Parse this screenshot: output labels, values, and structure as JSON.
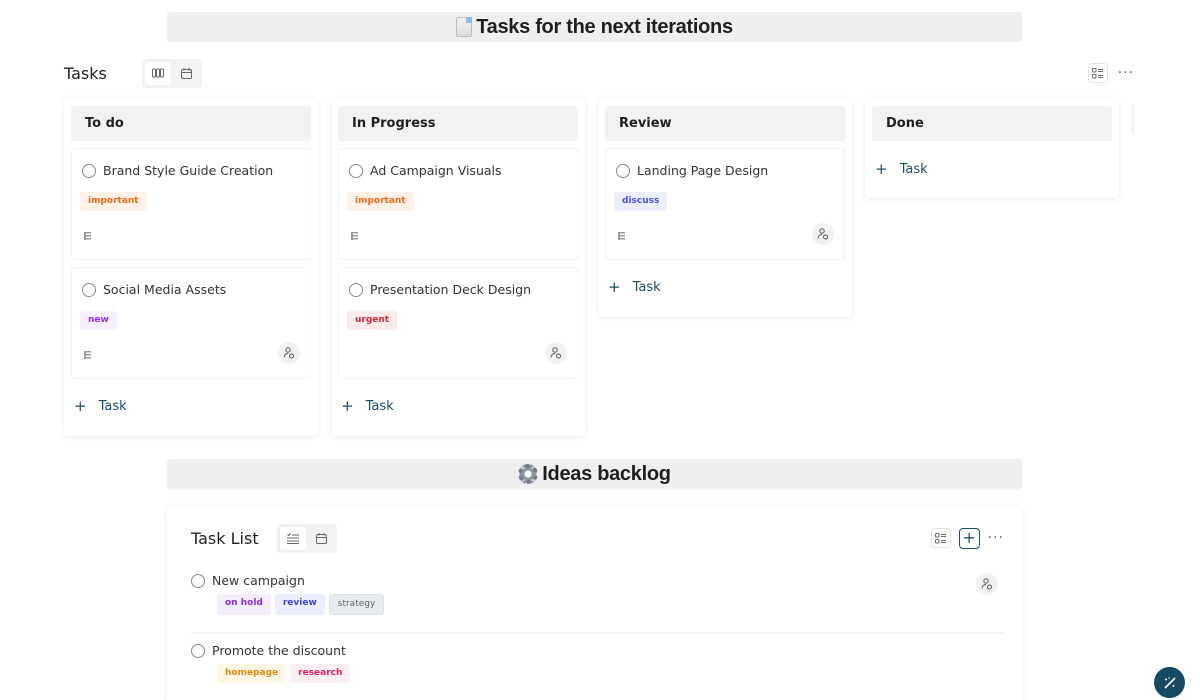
{
  "sections": [
    {
      "emoji": "page-facing-up",
      "title": "Tasks for the next iterations"
    },
    {
      "emoji": "gear",
      "title": "Ideas backlog"
    }
  ],
  "board": {
    "title": "Tasks",
    "views": [
      {
        "icon": "board-view-icon",
        "active": true
      },
      {
        "icon": "calendar-icon",
        "active": false
      }
    ],
    "tools": {
      "filter_icon": "checklist-filter-icon",
      "more_label": "···"
    },
    "add_task_label": "Task",
    "columns": [
      {
        "name": "To do",
        "cards": [
          {
            "title": "Brand Style Guide Creation",
            "tag": {
              "label": "important",
              "color": "#f06b1f",
              "bg": "#fff1e6"
            },
            "has_description": true,
            "has_assignee_btn": false
          },
          {
            "title": "Social Media Assets",
            "tag": {
              "label": "new",
              "color": "#9b2cf0",
              "bg": "#f7eefe"
            },
            "has_description": true,
            "has_assignee_btn": true
          }
        ]
      },
      {
        "name": "In Progress",
        "cards": [
          {
            "title": "Ad Campaign Visuals",
            "tag": {
              "label": "important",
              "color": "#f06b1f",
              "bg": "#fff1e6"
            },
            "has_description": true,
            "has_assignee_btn": false
          },
          {
            "title": "Presentation Deck Design",
            "tag": {
              "label": "urgent",
              "color": "#e0263a",
              "bg": "#fdebec"
            },
            "has_description": false,
            "has_assignee_btn": true
          }
        ]
      },
      {
        "name": "Review",
        "cards": [
          {
            "title": "Landing Page Design",
            "tag": {
              "label": "discuss",
              "color": "#4b4fe0",
              "bg": "#ebefff"
            },
            "has_description": true,
            "has_assignee_btn": true
          }
        ]
      },
      {
        "name": "Done",
        "cards": []
      }
    ]
  },
  "task_list": {
    "title": "Task List",
    "views": [
      {
        "icon": "list-view-icon",
        "active": true
      },
      {
        "icon": "calendar-icon",
        "active": false
      }
    ],
    "tools": {
      "filter_icon": "checklist-filter-icon",
      "add_label": "+",
      "more_label": "···"
    },
    "items": [
      {
        "title": "New campaign",
        "has_assignee_btn": true,
        "tags": [
          {
            "label": "on hold",
            "color": "#8a2be2",
            "bg": "#f5eefe"
          },
          {
            "label": "review",
            "color": "#3d48d6",
            "bg": "#eaeefe"
          },
          {
            "label": "strategy",
            "color": "#5b6570",
            "bg": "#e9ecef"
          }
        ]
      },
      {
        "title": "Promote the discount",
        "has_assignee_btn": false,
        "tags": [
          {
            "label": "homepage",
            "color": "#e08a12",
            "bg": "#fff7e4"
          },
          {
            "label": "research",
            "color": "#e0246b",
            "bg": "#fdeef4"
          }
        ]
      }
    ]
  },
  "fab": {
    "icon": "magic-wand-icon"
  },
  "colors": {
    "accent": "#174b63",
    "banner_bg": "#efefef",
    "column_header_bg": "#f2f2f2"
  }
}
